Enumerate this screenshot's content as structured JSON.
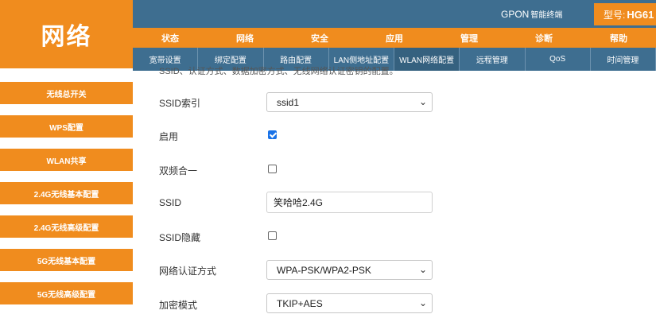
{
  "left_panel": {
    "title": "网络",
    "items": [
      {
        "label": "无线总开关"
      },
      {
        "label": "WPS配置"
      },
      {
        "label": "WLAN共享"
      },
      {
        "label": "2.4G无线基本配置"
      },
      {
        "label": "2.4G无线高级配置"
      },
      {
        "label": "5G无线基本配置"
      },
      {
        "label": "5G无线高级配置"
      }
    ]
  },
  "header": {
    "brand": "GPON",
    "brand_sub": "智能终端",
    "model_label": "型号:",
    "model_value": "HG61"
  },
  "main_nav": [
    {
      "label": "状态"
    },
    {
      "label": "网络"
    },
    {
      "label": "安全"
    },
    {
      "label": "应用"
    },
    {
      "label": "管理"
    },
    {
      "label": "诊断"
    },
    {
      "label": "帮助"
    }
  ],
  "sub_nav": [
    {
      "label": "宽带设置"
    },
    {
      "label": "绑定配置"
    },
    {
      "label": "路由配置"
    },
    {
      "label": "LAN侧地址配置"
    },
    {
      "label": "WLAN网络配置",
      "active": true
    },
    {
      "label": "远程管理"
    },
    {
      "label": "QoS"
    },
    {
      "label": "时间管理"
    }
  ],
  "content": {
    "clipped_text": "SSID、认证方式、数据加密方式、无线网络认证密钥的配置。",
    "ssid_index": {
      "label": "SSID索引",
      "value": "ssid1"
    },
    "enable": {
      "label": "启用",
      "checked": true
    },
    "dual_band": {
      "label": "双频合一",
      "checked": false
    },
    "ssid": {
      "label": "SSID",
      "value": "笑哈哈2.4G"
    },
    "ssid_hidden": {
      "label": "SSID隐藏",
      "checked": false
    },
    "auth_mode": {
      "label": "网络认证方式",
      "value": "WPA-PSK/WPA2-PSK"
    },
    "encryption": {
      "label": "加密模式",
      "value": "TKIP+AES"
    }
  },
  "colors": {
    "orange": "#f08c1e",
    "blue": "#3e6e90",
    "checkbox_blue": "#1a73e8"
  }
}
